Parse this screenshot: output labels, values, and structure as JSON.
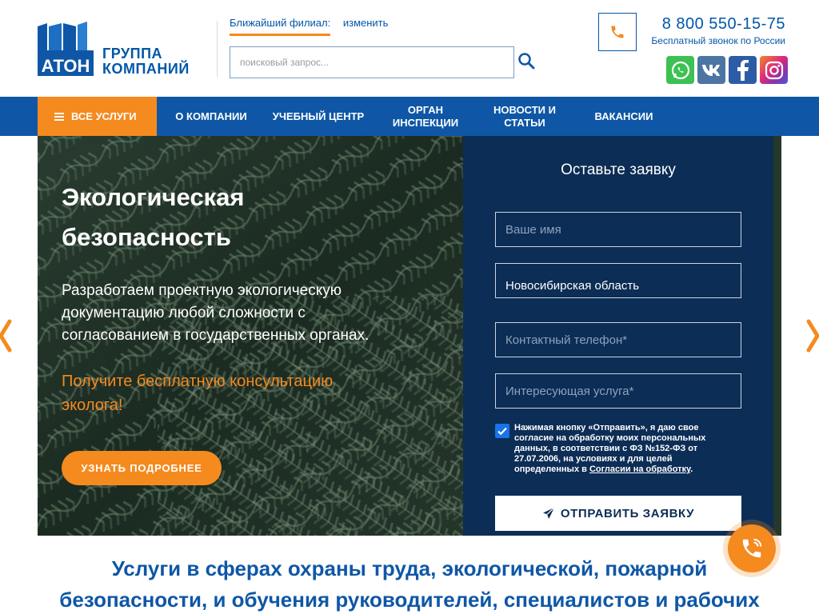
{
  "header": {
    "logo_mark_text": "АТОН",
    "logo_line1": "ГРУППА",
    "logo_line2": "КОМПАНИЙ",
    "branch_label": "Ближайший филиал:",
    "branch_change": "изменить",
    "search_placeholder": "поисковый запрос...",
    "phone_number": "8 800 550-15-75",
    "phone_note": "Бесплатный звонок по России",
    "socials": [
      "whatsapp-icon",
      "vk-icon",
      "facebook-icon",
      "instagram-icon"
    ]
  },
  "nav": {
    "all_services": "ВСЕ УСЛУГИ",
    "items": [
      {
        "line1": "О КОМПАНИИ",
        "line2": ""
      },
      {
        "line1": "УЧЕБНЫЙ ЦЕНТР",
        "line2": ""
      },
      {
        "line1": "ОРГАН",
        "line2": "ИНСПЕКЦИИ"
      },
      {
        "line1": "НОВОСТИ И",
        "line2": "СТАТЬИ"
      },
      {
        "line1": "ВАКАНСИИ",
        "line2": ""
      }
    ]
  },
  "hero": {
    "title_line1": "Экологическая",
    "title_line2": "безопасность",
    "desc_line1": "Разработаем проектную экологическую",
    "desc_line2": "документацию любой сложности с",
    "desc_line3": "согласованием в государственных органах.",
    "cta_line1": "Получите бесплатную консультацию",
    "cta_line2": "эколога!",
    "button": "УЗНАТЬ ПОДРОБНЕЕ"
  },
  "form": {
    "title": "Оставьте заявку",
    "name_placeholder": "Ваше имя",
    "region_value": "Новосибирская область",
    "phone_placeholder": "Контактный телефон*",
    "service_placeholder": "Интересующая услуга*",
    "consent_checked": true,
    "consent_line1": "Нажимая кнопку «Отправить», я даю свое",
    "consent_line2": "согласие на обработку моих персональных",
    "consent_line3": "данных, в соответствии с ФЗ №152-ФЗ от",
    "consent_line4": "27.07.2006, на условиях и для целей",
    "consent_line5": "определенных в",
    "consent_link": "Согласии на обработку",
    "consent_end": ".",
    "submit": "ОТПРАВИТЬ ЗАЯВКУ"
  },
  "services": {
    "heading_line1": "Услуги в сферах охраны труда, экологической, пожарной",
    "heading_line2": "безопасности, и обучения руководителей, специалистов и рабочих"
  },
  "colors": {
    "brand_blue": "#0f57a6",
    "accent_orange": "#f58a1f",
    "form_navy": "#0c2d55"
  }
}
